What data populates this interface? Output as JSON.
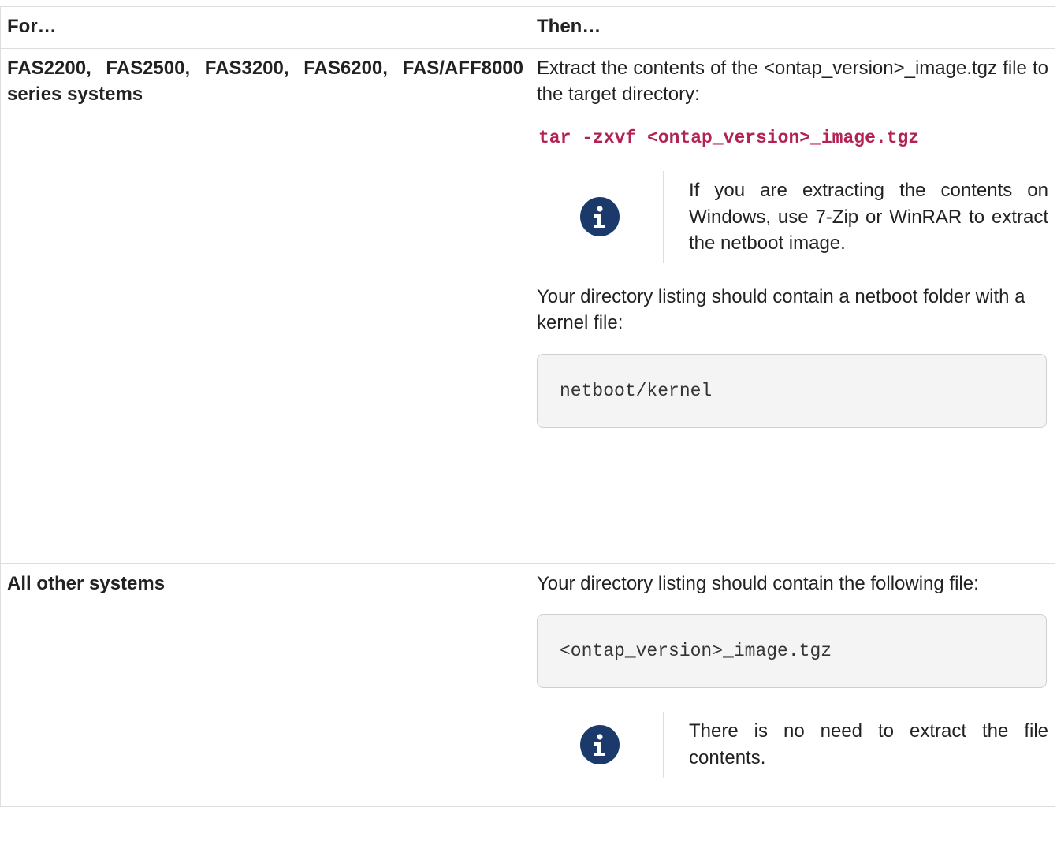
{
  "table": {
    "headers": [
      "For…",
      "Then…"
    ],
    "row1": {
      "for": "FAS2200, FAS2500, FAS3200, FAS6200, FAS/AFF8000 series systems",
      "intro": "Extract the contents of the <ontap_version>_image.tgz file to the target directory:",
      "command": "tar -zxvf <ontap_version>_image.tgz",
      "note": "If you are extracting the contents on Windows, use 7-Zip or WinRAR to extract the netboot image.",
      "listing_text": "Your directory listing should contain a netboot folder with a kernel file:",
      "listing_code": "netboot/kernel"
    },
    "row2": {
      "for": "All other systems",
      "listing_text": "Your directory listing should contain the following file:",
      "listing_code": "<ontap_version>_image.tgz",
      "note": "There is no need to extract the file contents."
    }
  },
  "icons": {
    "info": "info-icon"
  },
  "colors": {
    "command": "#b22252",
    "info_icon_bg": "#1b3a6b",
    "code_bg": "#f4f4f4"
  }
}
